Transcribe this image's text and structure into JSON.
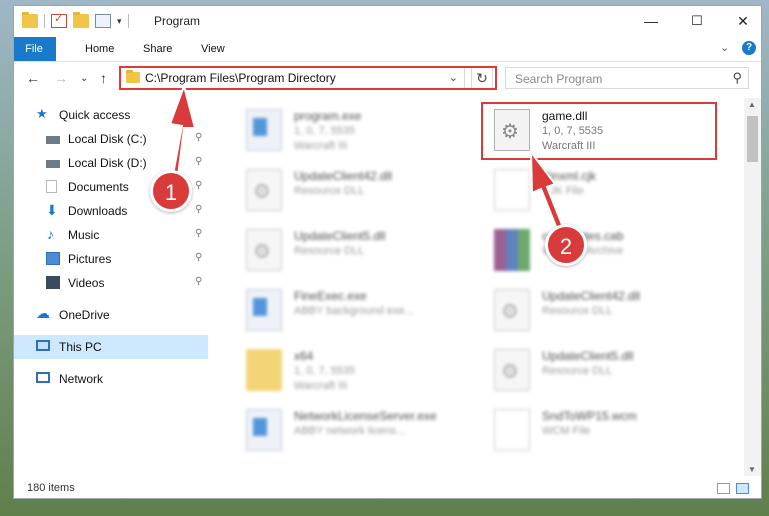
{
  "window": {
    "title": "Program",
    "controls": {
      "minimize": "—",
      "maximize": "☐",
      "close": "✕"
    }
  },
  "ribbon": {
    "tabs": [
      "File",
      "Home",
      "Share",
      "View"
    ],
    "expand_glyph": "⌄",
    "help_glyph": "?"
  },
  "nav": {
    "back_glyph": "←",
    "forward_glyph": "→",
    "recent_glyph": "⌄",
    "up_glyph": "↑",
    "address": "C:\\Program Files\\Program Directory",
    "address_dropdown_glyph": "⌄",
    "refresh_glyph": "↻",
    "search_placeholder": "Search Program",
    "search_glyph": "⚲"
  },
  "sidebar": {
    "items": [
      {
        "label": "Quick access",
        "icon": "star-icon",
        "pinned": false
      },
      {
        "label": "Local Disk (C:)",
        "icon": "drive-icon",
        "pinned": true
      },
      {
        "label": "Local Disk (D:)",
        "icon": "drive-icon",
        "pinned": true
      },
      {
        "label": "Documents",
        "icon": "documents-icon",
        "pinned": true
      },
      {
        "label": "Downloads",
        "icon": "download-icon",
        "pinned": true
      },
      {
        "label": "Music",
        "icon": "music-icon",
        "pinned": true
      },
      {
        "label": "Pictures",
        "icon": "pictures-icon",
        "pinned": true
      },
      {
        "label": "Videos",
        "icon": "videos-icon",
        "pinned": true
      },
      {
        "label": "OneDrive",
        "icon": "cloud-icon",
        "pinned": false
      },
      {
        "label": "This PC",
        "icon": "pc-icon",
        "pinned": false,
        "selected": true
      },
      {
        "label": "Network",
        "icon": "network-icon",
        "pinned": false
      }
    ],
    "pin_glyph": "📌"
  },
  "files": [
    {
      "name": "program.exe",
      "line1": "1, 0, 7, 5535",
      "line2": "Warcraft III",
      "icon": "exe-icon"
    },
    {
      "name": "game.dll",
      "line1": "1, 0, 7, 5535",
      "line2": "Warcraft III",
      "icon": "gear-file-icon",
      "highlighted": true
    },
    {
      "name": "UpdateClient42.dll",
      "line1": "Resource DLL",
      "line2": "",
      "icon": "gear-file-icon"
    },
    {
      "name": "Binxml.cjk",
      "line1": "CJK File",
      "line2": "",
      "icon": "document-icon"
    },
    {
      "name": "UpdateClient5.dll",
      "line1": "Resource DLL",
      "line2": "",
      "icon": "gear-file-icon"
    },
    {
      "name": "cs-updates.cab",
      "line1": "WinRAR Archive",
      "line2": "",
      "icon": "archive-icon"
    },
    {
      "name": "FineExec.exe",
      "line1": "ABBY background exe...",
      "line2": "",
      "icon": "exe-icon"
    },
    {
      "name": "UpdateClient42.dll",
      "line1": "Resource DLL",
      "line2": "",
      "icon": "gear-file-icon"
    },
    {
      "name": "x64",
      "line1": "1, 0, 7, 5535",
      "line2": "Warcraft III",
      "icon": "folder-icon"
    },
    {
      "name": "UpdateClient5.dll",
      "line1": "Resource DLL",
      "line2": "",
      "icon": "gear-file-icon"
    },
    {
      "name": "NetworkLicenseServer.exe",
      "line1": "ABBY network licens...",
      "line2": "",
      "icon": "exe-icon"
    },
    {
      "name": "SndToWP15.wcm",
      "line1": "WCM File",
      "line2": "",
      "icon": "document-icon"
    }
  ],
  "status": {
    "item_count": "180 items"
  },
  "annotations": {
    "step1": "1",
    "step2": "2",
    "color": "#d93a3a"
  }
}
